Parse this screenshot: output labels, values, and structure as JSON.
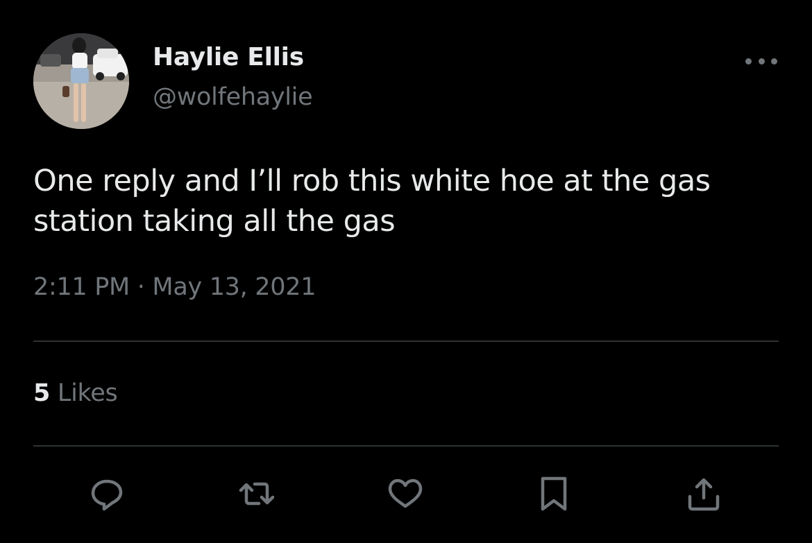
{
  "author": {
    "name": "Haylie Ellis",
    "handle": "@wolfehaylie",
    "avatar": "profile-photo"
  },
  "tweet": {
    "text": "One reply and I’ll rob this white hoe at the gas station taking all the gas",
    "time": "2:11 PM",
    "separator": "·",
    "date": "May 13, 2021"
  },
  "stats": {
    "likes_count": "5",
    "likes_label": "Likes"
  },
  "actions": [
    {
      "icon": "reply-icon"
    },
    {
      "icon": "retweet-icon"
    },
    {
      "icon": "like-icon"
    },
    {
      "icon": "bookmark-icon"
    },
    {
      "icon": "share-icon"
    }
  ],
  "colors": {
    "background": "#000000",
    "primary_text": "#e7e9ea",
    "secondary_text": "#71767b",
    "divider": "#2f3336"
  }
}
